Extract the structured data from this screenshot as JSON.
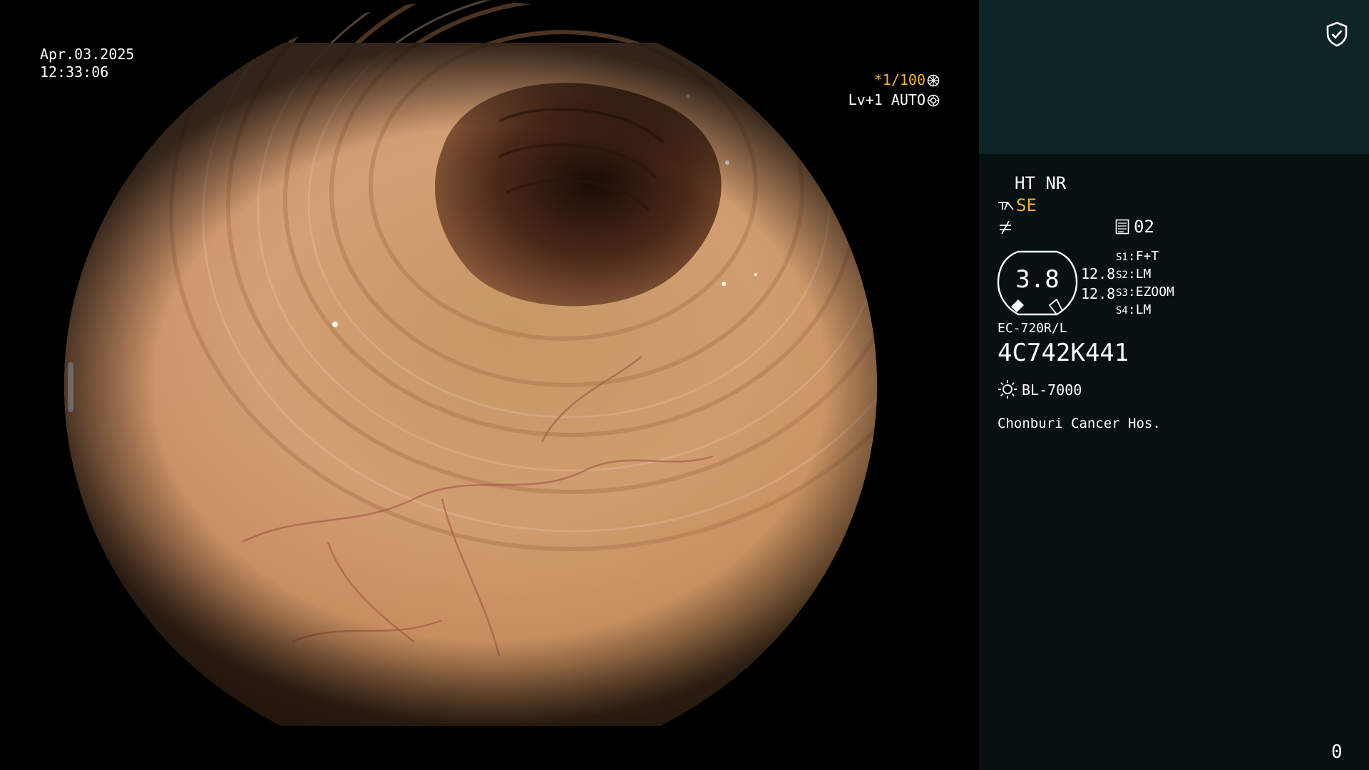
{
  "osd": {
    "date": "Apr.03.2025",
    "time": "12:33:06",
    "magnification": "*1/100",
    "iris": "Lv+1 AUTO"
  },
  "panel": {
    "enhancement": "HT NR",
    "mode": "SE",
    "page": "02",
    "gauge_value": "3.8",
    "values": [
      "12.8",
      "12.8"
    ],
    "switches": [
      {
        "key": "S1",
        "value": "F+T"
      },
      {
        "key": "S2",
        "value": "LM"
      },
      {
        "key": "S3",
        "value": "EZOOM"
      },
      {
        "key": "S4",
        "value": "LM"
      }
    ],
    "scope_model": "EC-720R/L",
    "scope_serial": "4C742K441",
    "light_source": "BL-7000",
    "hospital": "Chonburi Cancer Hos.",
    "counter": "0"
  },
  "colors": {
    "panel_top": "#0e2528",
    "panel_body": "#071112",
    "accent": "#f0b040",
    "text": "#ffffff"
  },
  "icons": [
    "shield-check-icon",
    "spin-icon",
    "iris-icon",
    "scope-tip-icon",
    "not-equal-icon",
    "memo-icon",
    "sun-icon"
  ]
}
